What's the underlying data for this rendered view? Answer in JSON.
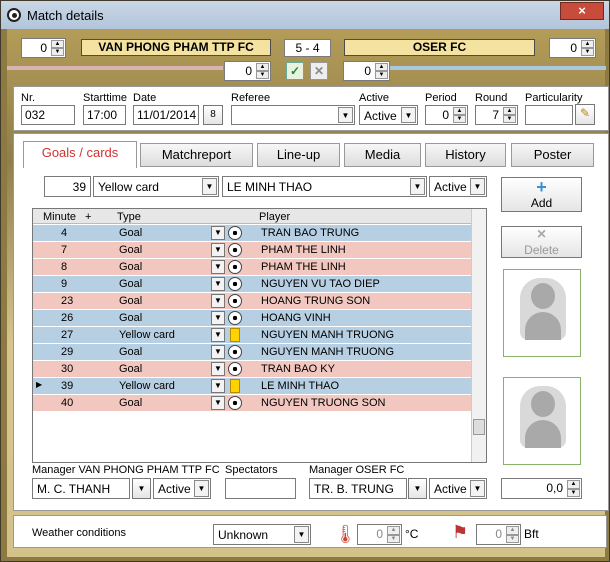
{
  "title": "Match details",
  "teams": {
    "home": "VAN PHONG PHAM TTP FC",
    "away": "OSER FC",
    "score": "5 - 4",
    "home_left": "0",
    "away_right": "0",
    "home_extra": "0",
    "away_extra": "0"
  },
  "info": {
    "nr_label": "Nr.",
    "nr": "032",
    "start_label": "Starttime",
    "start": "17:00",
    "date_label": "Date",
    "date": "11/01/2014",
    "calendar_text": "8",
    "referee_label": "Referee",
    "active_label": "Active",
    "active": "Active",
    "period_label": "Period",
    "period": "0",
    "round_label": "Round",
    "round": "7",
    "particularity_label": "Particularity"
  },
  "tabs": [
    {
      "label": "Goals / cards"
    },
    {
      "label": "Matchreport"
    },
    {
      "label": "Line-up"
    },
    {
      "label": "Media"
    },
    {
      "label": "History"
    },
    {
      "label": "Poster"
    }
  ],
  "edit": {
    "minute": "39",
    "type": "Yellow card",
    "player": "LE MINH THAO",
    "status": "Active"
  },
  "grid": {
    "headers": {
      "minute": "Minute",
      "plus": "+",
      "type": "Type",
      "player": "Player"
    },
    "rows": [
      {
        "minute": "4",
        "type": "Goal",
        "player": "TRAN BAO TRUNG",
        "team": "blue",
        "icon": "ball"
      },
      {
        "minute": "7",
        "type": "Goal",
        "player": "PHAM THE LINH",
        "team": "pink",
        "icon": "ball"
      },
      {
        "minute": "8",
        "type": "Goal",
        "player": "PHAM THE LINH",
        "team": "pink",
        "icon": "ball"
      },
      {
        "minute": "9",
        "type": "Goal",
        "player": "NGUYEN VU TAO DIEP",
        "team": "blue",
        "icon": "ball"
      },
      {
        "minute": "23",
        "type": "Goal",
        "player": "HOANG TRUNG SON",
        "team": "pink",
        "icon": "ball"
      },
      {
        "minute": "26",
        "type": "Goal",
        "player": "HOANG VINH",
        "team": "blue",
        "icon": "ball"
      },
      {
        "minute": "27",
        "type": "Yellow card",
        "player": "NGUYEN MANH TRUONG",
        "team": "blue",
        "icon": "card"
      },
      {
        "minute": "29",
        "type": "Goal",
        "player": "NGUYEN MANH TRUONG",
        "team": "blue",
        "icon": "ball"
      },
      {
        "minute": "30",
        "type": "Goal",
        "player": "TRAN BAO KY",
        "team": "pink",
        "icon": "ball"
      },
      {
        "minute": "39",
        "type": "Yellow card",
        "player": "LE MINH THAO",
        "team": "blue",
        "icon": "card",
        "selected": true
      },
      {
        "minute": "40",
        "type": "Goal",
        "player": "NGUYEN TRUONG SON",
        "team": "pink",
        "icon": "ball"
      }
    ]
  },
  "buttons": {
    "add": "Add",
    "delete": "Delete"
  },
  "managers": {
    "home_label": "Manager VAN PHONG PHAM TTP FC",
    "home_name": "M. C. THANH",
    "home_status": "Active",
    "spectators_label": "Spectators",
    "away_label": "Manager OSER FC",
    "away_name": "TR. B. TRUNG",
    "away_status": "Active",
    "ratio": "0,0"
  },
  "weather": {
    "label": "Weather conditions",
    "condition": "Unknown",
    "temperature": "0",
    "temperature_unit": "°C",
    "wind": "0",
    "wind_unit": "Bft"
  }
}
